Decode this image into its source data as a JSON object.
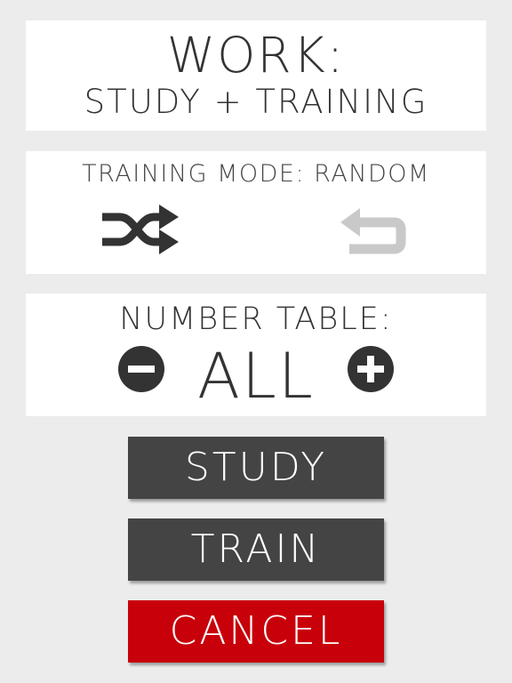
{
  "header": {
    "title": "WORK:",
    "subtitle": "STUDY + TRAINING"
  },
  "mode": {
    "label": "TRAINING MODE: RANDOM",
    "icons": {
      "shuffle": "shuffle-icon",
      "repeat": "repeat-icon"
    }
  },
  "number_table": {
    "label": "NUMBER TABLE:",
    "value": "ALL",
    "icons": {
      "decrease": "minus-circle-icon",
      "increase": "plus-circle-icon"
    }
  },
  "actions": {
    "study_label": "STUDY",
    "train_label": "TRAIN",
    "cancel_label": "CANCEL"
  },
  "colors": {
    "background": "#ececec",
    "panel": "#ffffff",
    "text": "#333333",
    "button_dark": "#444444",
    "button_cancel": "#c8000a",
    "inactive_icon": "#c9c9c9"
  }
}
